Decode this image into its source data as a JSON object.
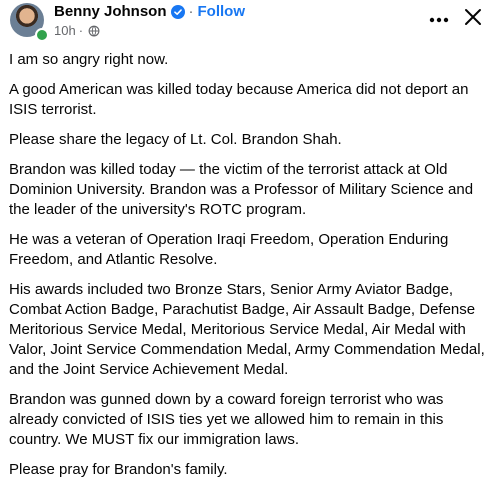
{
  "post": {
    "author": "Benny Johnson",
    "follow_label": "Follow",
    "separator": "·",
    "time": "10h",
    "time_separator": "·",
    "paragraphs": [
      "I am so angry right now.",
      "A good American was killed today because America did not deport an ISIS terrorist.",
      "Please share the legacy of Lt. Col. Brandon Shah.",
      "Brandon was killed today — the victim of the terrorist attack at Old Dominion University. Brandon was a Professor of Military Science and the leader of the university's ROTC program.",
      "He was a veteran of Operation Iraqi Freedom, Operation Enduring Freedom, and Atlantic Resolve.",
      "His awards included two Bronze Stars, Senior Army Aviator Badge, Combat Action Badge, Parachutist Badge, Air Assault Badge, Defense Meritorious Service Medal, Meritorious Service Medal, Air Medal with Valor, Joint Service Commendation Medal, Army Commendation Medal, and the Joint Service Achievement Medal.",
      "Brandon was gunned down by a coward foreign terrorist who was already convicted of ISIS ties yet we allowed him to remain in this country. We MUST fix our immigration laws.",
      "Please pray for Brandon's family."
    ]
  },
  "icons": {
    "verified": "verified-badge-icon",
    "audience": "globe-icon",
    "more": "more-horizontal-icon",
    "close": "close-icon"
  },
  "colors": {
    "link": "#1877f2",
    "verified": "#1877f2",
    "online": "#31a24c",
    "secondary_text": "#65676b"
  }
}
